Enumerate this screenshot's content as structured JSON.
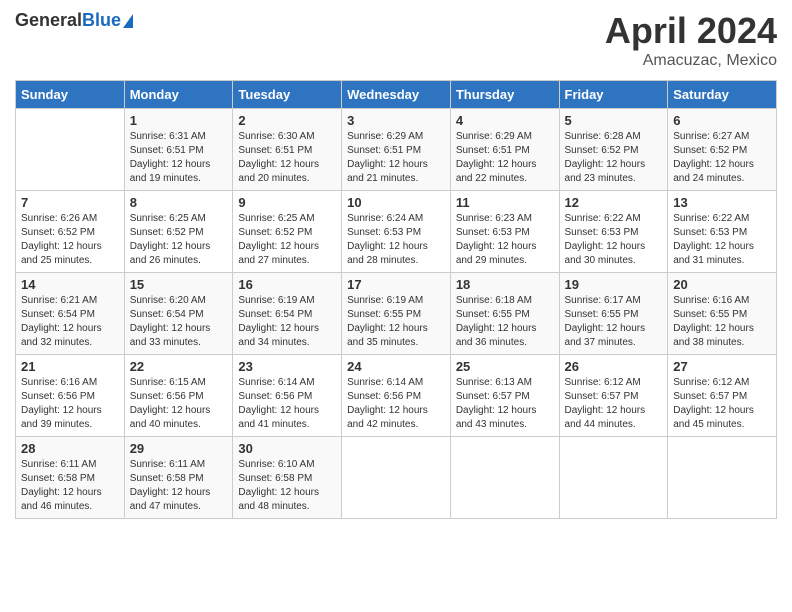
{
  "header": {
    "logo_general": "General",
    "logo_blue": "Blue",
    "title_month": "April 2024",
    "title_location": "Amacuzac, Mexico"
  },
  "columns": [
    "Sunday",
    "Monday",
    "Tuesday",
    "Wednesday",
    "Thursday",
    "Friday",
    "Saturday"
  ],
  "weeks": [
    [
      {
        "day": "",
        "info": ""
      },
      {
        "day": "1",
        "info": "Sunrise: 6:31 AM\nSunset: 6:51 PM\nDaylight: 12 hours\nand 19 minutes."
      },
      {
        "day": "2",
        "info": "Sunrise: 6:30 AM\nSunset: 6:51 PM\nDaylight: 12 hours\nand 20 minutes."
      },
      {
        "day": "3",
        "info": "Sunrise: 6:29 AM\nSunset: 6:51 PM\nDaylight: 12 hours\nand 21 minutes."
      },
      {
        "day": "4",
        "info": "Sunrise: 6:29 AM\nSunset: 6:51 PM\nDaylight: 12 hours\nand 22 minutes."
      },
      {
        "day": "5",
        "info": "Sunrise: 6:28 AM\nSunset: 6:52 PM\nDaylight: 12 hours\nand 23 minutes."
      },
      {
        "day": "6",
        "info": "Sunrise: 6:27 AM\nSunset: 6:52 PM\nDaylight: 12 hours\nand 24 minutes."
      }
    ],
    [
      {
        "day": "7",
        "info": "Sunrise: 6:26 AM\nSunset: 6:52 PM\nDaylight: 12 hours\nand 25 minutes."
      },
      {
        "day": "8",
        "info": "Sunrise: 6:25 AM\nSunset: 6:52 PM\nDaylight: 12 hours\nand 26 minutes."
      },
      {
        "day": "9",
        "info": "Sunrise: 6:25 AM\nSunset: 6:52 PM\nDaylight: 12 hours\nand 27 minutes."
      },
      {
        "day": "10",
        "info": "Sunrise: 6:24 AM\nSunset: 6:53 PM\nDaylight: 12 hours\nand 28 minutes."
      },
      {
        "day": "11",
        "info": "Sunrise: 6:23 AM\nSunset: 6:53 PM\nDaylight: 12 hours\nand 29 minutes."
      },
      {
        "day": "12",
        "info": "Sunrise: 6:22 AM\nSunset: 6:53 PM\nDaylight: 12 hours\nand 30 minutes."
      },
      {
        "day": "13",
        "info": "Sunrise: 6:22 AM\nSunset: 6:53 PM\nDaylight: 12 hours\nand 31 minutes."
      }
    ],
    [
      {
        "day": "14",
        "info": "Sunrise: 6:21 AM\nSunset: 6:54 PM\nDaylight: 12 hours\nand 32 minutes."
      },
      {
        "day": "15",
        "info": "Sunrise: 6:20 AM\nSunset: 6:54 PM\nDaylight: 12 hours\nand 33 minutes."
      },
      {
        "day": "16",
        "info": "Sunrise: 6:19 AM\nSunset: 6:54 PM\nDaylight: 12 hours\nand 34 minutes."
      },
      {
        "day": "17",
        "info": "Sunrise: 6:19 AM\nSunset: 6:55 PM\nDaylight: 12 hours\nand 35 minutes."
      },
      {
        "day": "18",
        "info": "Sunrise: 6:18 AM\nSunset: 6:55 PM\nDaylight: 12 hours\nand 36 minutes."
      },
      {
        "day": "19",
        "info": "Sunrise: 6:17 AM\nSunset: 6:55 PM\nDaylight: 12 hours\nand 37 minutes."
      },
      {
        "day": "20",
        "info": "Sunrise: 6:16 AM\nSunset: 6:55 PM\nDaylight: 12 hours\nand 38 minutes."
      }
    ],
    [
      {
        "day": "21",
        "info": "Sunrise: 6:16 AM\nSunset: 6:56 PM\nDaylight: 12 hours\nand 39 minutes."
      },
      {
        "day": "22",
        "info": "Sunrise: 6:15 AM\nSunset: 6:56 PM\nDaylight: 12 hours\nand 40 minutes."
      },
      {
        "day": "23",
        "info": "Sunrise: 6:14 AM\nSunset: 6:56 PM\nDaylight: 12 hours\nand 41 minutes."
      },
      {
        "day": "24",
        "info": "Sunrise: 6:14 AM\nSunset: 6:56 PM\nDaylight: 12 hours\nand 42 minutes."
      },
      {
        "day": "25",
        "info": "Sunrise: 6:13 AM\nSunset: 6:57 PM\nDaylight: 12 hours\nand 43 minutes."
      },
      {
        "day": "26",
        "info": "Sunrise: 6:12 AM\nSunset: 6:57 PM\nDaylight: 12 hours\nand 44 minutes."
      },
      {
        "day": "27",
        "info": "Sunrise: 6:12 AM\nSunset: 6:57 PM\nDaylight: 12 hours\nand 45 minutes."
      }
    ],
    [
      {
        "day": "28",
        "info": "Sunrise: 6:11 AM\nSunset: 6:58 PM\nDaylight: 12 hours\nand 46 minutes."
      },
      {
        "day": "29",
        "info": "Sunrise: 6:11 AM\nSunset: 6:58 PM\nDaylight: 12 hours\nand 47 minutes."
      },
      {
        "day": "30",
        "info": "Sunrise: 6:10 AM\nSunset: 6:58 PM\nDaylight: 12 hours\nand 48 minutes."
      },
      {
        "day": "",
        "info": ""
      },
      {
        "day": "",
        "info": ""
      },
      {
        "day": "",
        "info": ""
      },
      {
        "day": "",
        "info": ""
      }
    ]
  ]
}
